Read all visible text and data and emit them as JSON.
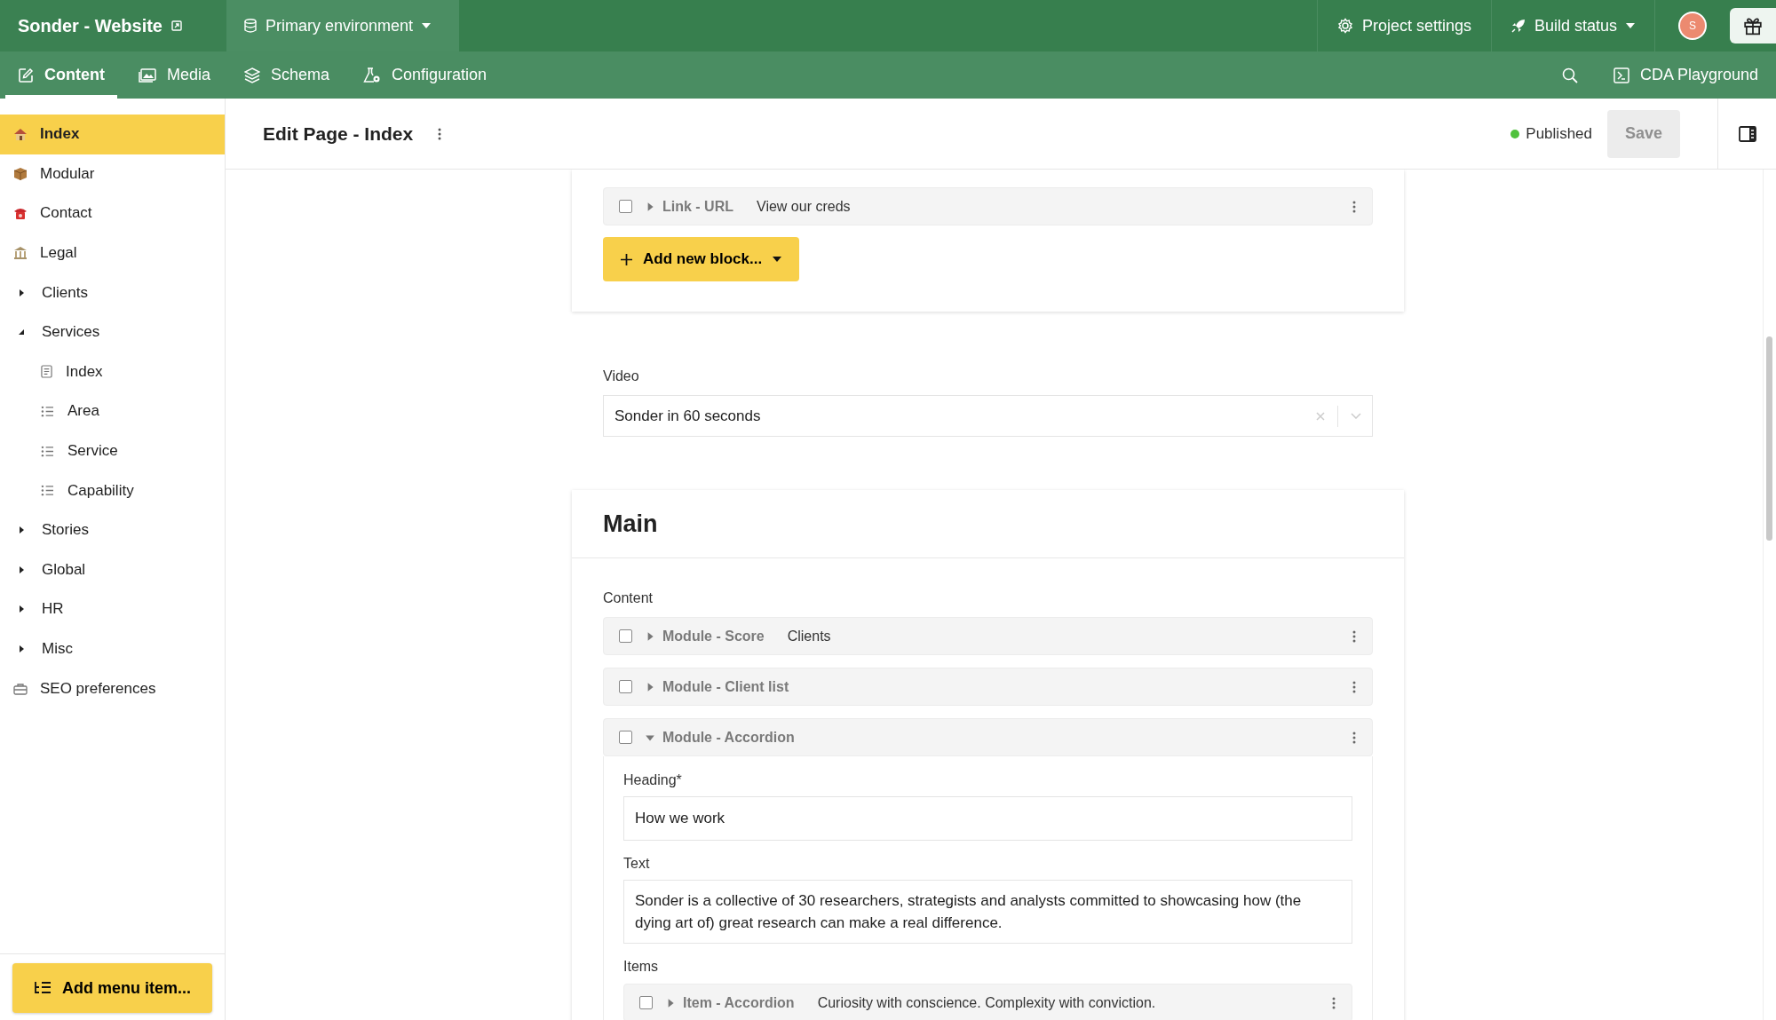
{
  "project": {
    "title": "Sonder - Website"
  },
  "environment": {
    "label": "Primary environment"
  },
  "top_actions": [
    {
      "kind": "settings",
      "label": "Project settings"
    },
    {
      "kind": "build",
      "label": "Build status"
    }
  ],
  "avatar": {
    "initial": "S"
  },
  "tabs": [
    {
      "label": "Content",
      "selected": true
    },
    {
      "label": "Media",
      "selected": false
    },
    {
      "label": "Schema",
      "selected": false
    },
    {
      "label": "Configuration",
      "selected": false
    }
  ],
  "playground": {
    "label": "CDA Playground"
  },
  "sidebar": {
    "items": [
      {
        "label": "Index",
        "kind": "page",
        "selected": true
      },
      {
        "label": "Modular",
        "kind": "page",
        "selected": false
      },
      {
        "label": "Contact",
        "kind": "page",
        "selected": false
      },
      {
        "label": "Legal",
        "kind": "page",
        "selected": false
      },
      {
        "label": "Clients",
        "kind": "folder",
        "expanded": false,
        "selected": false
      },
      {
        "label": "Services",
        "kind": "folder",
        "expanded": true,
        "selected": false,
        "children": [
          {
            "label": "Index",
            "kind": "document",
            "selected": false
          },
          {
            "label": "Area",
            "kind": "list",
            "selected": false
          },
          {
            "label": "Service",
            "kind": "list",
            "selected": false
          },
          {
            "label": "Capability",
            "kind": "list",
            "selected": false
          }
        ]
      },
      {
        "label": "Stories",
        "kind": "folder",
        "expanded": false,
        "selected": false
      },
      {
        "label": "Global",
        "kind": "folder",
        "expanded": false,
        "selected": false
      },
      {
        "label": "HR",
        "kind": "folder",
        "expanded": false,
        "selected": false
      },
      {
        "label": "Misc",
        "kind": "folder",
        "expanded": false,
        "selected": false
      },
      {
        "label": "SEO preferences",
        "kind": "tool",
        "selected": false
      }
    ],
    "add_button": "Add menu item..."
  },
  "editor": {
    "title": "Edit Page - Index",
    "status": "Published",
    "save": {
      "label": "Save",
      "disabled": true
    }
  },
  "links": {
    "blocks": [
      {
        "type": "Link - URL",
        "summary": "View our creds",
        "expanded": false,
        "checked": false
      }
    ],
    "add_block": "Add new block..."
  },
  "video": {
    "label": "Video",
    "value": "Sonder in 60 seconds"
  },
  "main": {
    "title": "Main",
    "content_label": "Content",
    "blocks": [
      {
        "type": "Module - Score",
        "summary": "Clients",
        "expanded": false,
        "checked": false
      },
      {
        "type": "Module - Client list",
        "expanded": false,
        "checked": false
      },
      {
        "type": "Module - Accordion",
        "expanded": true,
        "checked": false,
        "heading_label": "Heading*",
        "heading": "How we work",
        "text_label": "Text",
        "text": "Sonder is a collective of 30 researchers, strategists and analysts committed to showcasing how (the dying art of) great research can make a real difference.",
        "items_label": "Items",
        "items": [
          {
            "type": "Item - Accordion",
            "summary": "Curiosity with conscience. Complexity with conviction.",
            "expanded": false,
            "checked": false
          }
        ]
      }
    ]
  }
}
